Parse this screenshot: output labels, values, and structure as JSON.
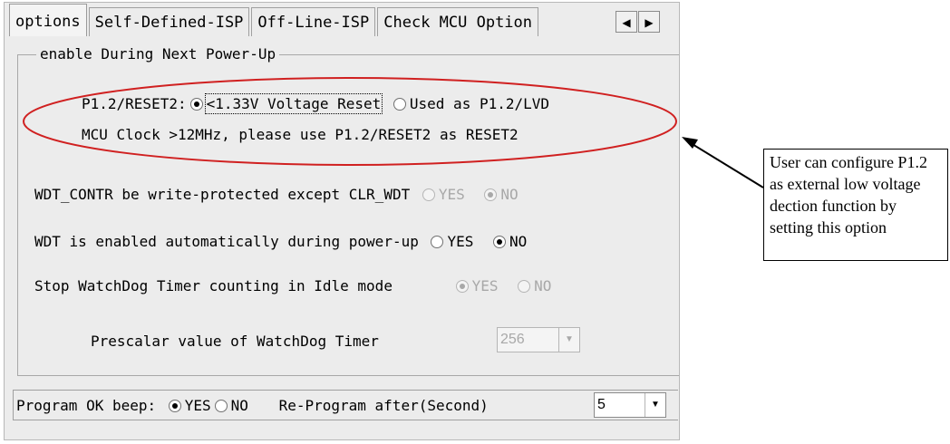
{
  "tabs": [
    {
      "label": "options"
    },
    {
      "label": "Self-Defined-ISP"
    },
    {
      "label": "Off-Line-ISP"
    },
    {
      "label": "Check MCU Option"
    }
  ],
  "scroll": {
    "left_glyph": "◀",
    "right_glyph": "▶"
  },
  "group": {
    "title": "enable During Next Power-Up",
    "p12_label": "P1.2/RESET2:",
    "p12_opt1": "<1.33V Voltage Reset",
    "p12_opt2": "Used as P1.2/LVD",
    "mcu_note": "MCU Clock >12MHz, please use P1.2/RESET2 as RESET2",
    "wdt_protect_label": "WDT_CONTR be write-protected except CLR_WDT",
    "wdt_auto_label": "WDT is enabled automatically during power-up",
    "stop_wdt_label": "Stop WatchDog Timer counting in Idle mode",
    "yes": "YES",
    "no": "NO",
    "prescalar_label": "Prescalar value of WatchDog Timer",
    "prescalar_value": "256"
  },
  "bottom": {
    "beep_label": "Program OK beep:",
    "yes": "YES",
    "no": "NO",
    "reprogram_label": "Re-Program after(Second)",
    "reprogram_value": "5"
  },
  "annotation": {
    "text": "User can configure P1.2 as external low voltage dection function by setting this option"
  },
  "colors": {
    "ellipse": "#d02020",
    "arrow": "#000000"
  }
}
